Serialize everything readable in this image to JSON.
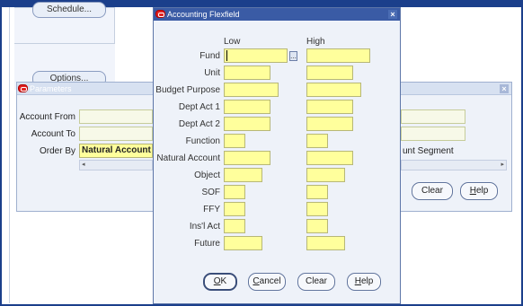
{
  "background": {
    "schedule_button": "Schedule...",
    "options_button": "Options..."
  },
  "parameters": {
    "title": "Parameters",
    "account_from_label": "Account From",
    "account_to_label": "Account To",
    "order_by_label": "Order By",
    "order_by_value": "Natural Account",
    "segment_label": "unt Segment",
    "clear_label": "Clear",
    "help_mnemonic": "H",
    "help_rest": "elp"
  },
  "dialog": {
    "title": "Accounting Flexfield",
    "low_header": "Low",
    "high_header": "High",
    "segments": [
      {
        "label": "Fund"
      },
      {
        "label": "Unit"
      },
      {
        "label": "Budget Purpose"
      },
      {
        "label": "Dept Act 1"
      },
      {
        "label": "Dept Act 2"
      },
      {
        "label": "Function"
      },
      {
        "label": "Natural Account"
      },
      {
        "label": "Object"
      },
      {
        "label": "SOF"
      },
      {
        "label": "FFY"
      },
      {
        "label": "Ins'l Act"
      },
      {
        "label": "Future"
      }
    ],
    "lov_glyph": "...",
    "buttons": {
      "ok_mnemonic": "O",
      "ok_rest": "K",
      "cancel_mnemonic": "C",
      "cancel_rest": "ancel",
      "clear": "Clear",
      "help_mnemonic": "H",
      "help_rest": "elp"
    }
  },
  "icons": {
    "oracle": "oracle-logo-icon",
    "close": "close-icon",
    "scroll_left": "chevron-left-icon",
    "scroll_right": "chevron-right-icon"
  },
  "colors": {
    "title_bar": "#3a5ba5",
    "field_yellow": "#ffff9c",
    "frame": "#1b3f8b"
  }
}
